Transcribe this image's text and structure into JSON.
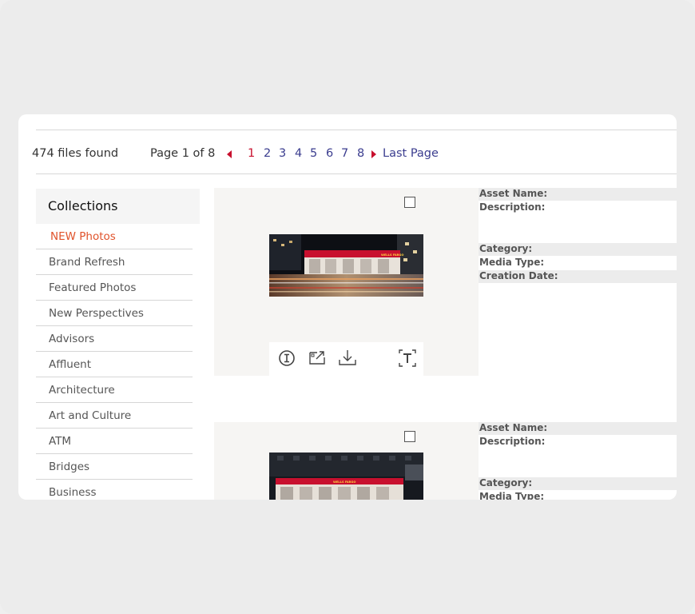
{
  "results": {
    "files_found": "474 files found",
    "page_of": "Page 1 of 8",
    "pages": [
      "1",
      "2",
      "3",
      "4",
      "5",
      "6",
      "7",
      "8"
    ],
    "current_page": "1",
    "last_page": "Last Page"
  },
  "collections": {
    "title": "Collections",
    "items": [
      "NEW Photos",
      "Brand Refresh",
      "Featured Photos",
      "New Perspectives",
      "Advisors",
      "Affluent",
      "Architecture",
      "Art and Culture",
      "ATM",
      "Bridges",
      "Business"
    ],
    "active_item": "NEW Photos"
  },
  "assets": [
    {
      "photo_sign": "WELLS FARGO",
      "labels": {
        "asset_name": "Asset Name:",
        "description": "Description:",
        "category": "Category:",
        "media_type": "Media Type:",
        "creation_date": "Creation Date:"
      }
    },
    {
      "photo_sign": "WELLS FARGO",
      "labels": {
        "asset_name": "Asset Name:",
        "description": "Description:",
        "category": "Category:",
        "media_type": "Media Type:"
      }
    }
  ],
  "toolbar_icons": [
    "info-icon",
    "share-icon",
    "download-icon",
    "text-recognition-icon"
  ],
  "colors": {
    "brand_red": "#c8102e",
    "link_blue": "#3b3d8f",
    "active_orange": "#e0522a",
    "panel_bg": "#f6f5f3"
  }
}
